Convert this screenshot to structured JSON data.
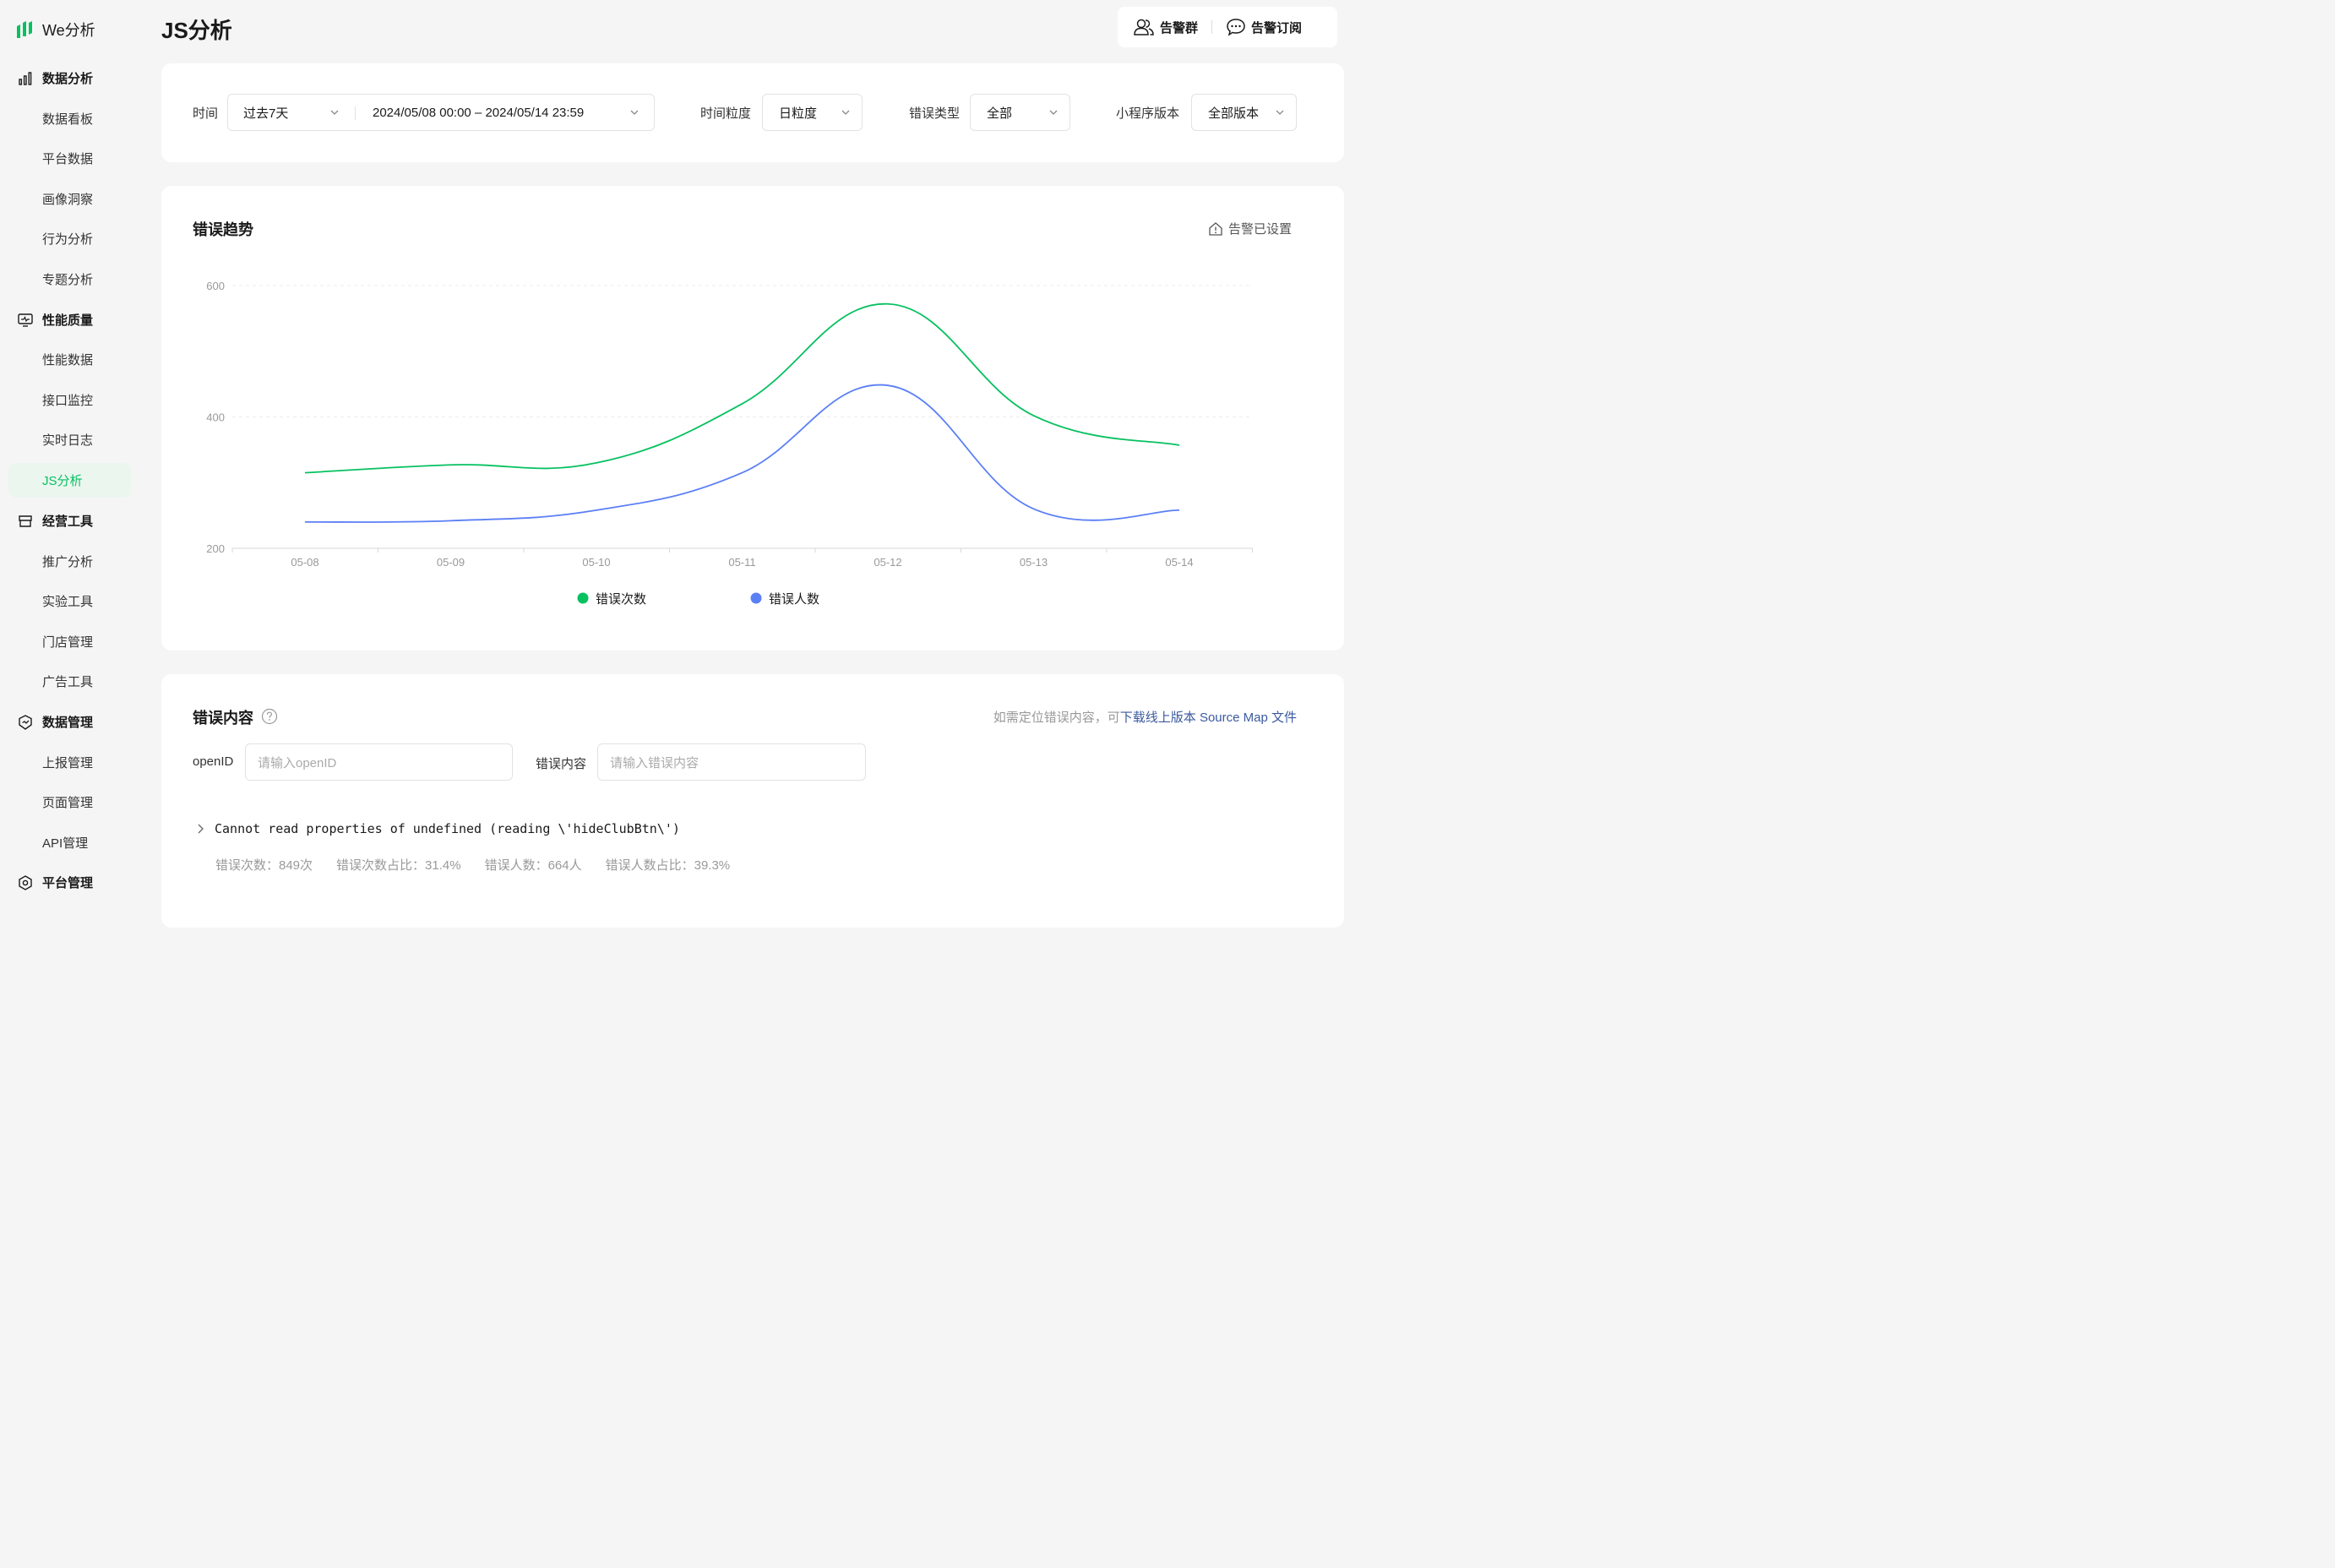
{
  "app": {
    "name": "We分析"
  },
  "sidebar": {
    "groups": [
      {
        "label": "数据分析",
        "icon": "bar-chart-icon",
        "items": [
          "数据看板",
          "平台数据",
          "画像洞察",
          "行为分析",
          "专题分析"
        ]
      },
      {
        "label": "性能质量",
        "icon": "monitor-icon",
        "items": [
          "性能数据",
          "接口监控",
          "实时日志",
          "JS分析"
        ]
      },
      {
        "label": "经营工具",
        "icon": "store-icon",
        "items": [
          "推广分析",
          "实验工具",
          "门店管理",
          "广告工具"
        ]
      },
      {
        "label": "数据管理",
        "icon": "shield-check-icon",
        "items": [
          "上报管理",
          "页面管理",
          "API管理"
        ]
      },
      {
        "label": "平台管理",
        "icon": "settings-icon",
        "items": []
      }
    ],
    "active_item": "JS分析"
  },
  "page": {
    "title": "JS分析"
  },
  "header_actions": {
    "alert_group": "告警群",
    "alert_subscribe": "告警订阅"
  },
  "filters": {
    "time_label": "时间",
    "time_preset": "过去7天",
    "time_range": "2024/05/08 00:00 – 2024/05/14 23:59",
    "granularity_label": "时间粒度",
    "granularity_value": "日粒度",
    "error_type_label": "错误类型",
    "error_type_value": "全部",
    "version_label": "小程序版本",
    "version_value": "全部版本"
  },
  "trend": {
    "title": "错误趋势",
    "alert_status": "告警已设置"
  },
  "chart_data": {
    "type": "line",
    "x": [
      "05-08",
      "05-09",
      "05-10",
      "05-11",
      "05-12",
      "05-13",
      "05-14"
    ],
    "series": [
      {
        "name": "错误次数",
        "color": "#07c160",
        "values": [
          315,
          327,
          330,
          420,
          572,
          402,
          357
        ]
      },
      {
        "name": "错误人数",
        "color": "#5b7ff6",
        "values": [
          240,
          242,
          258,
          315,
          448,
          260,
          258
        ]
      }
    ],
    "y_ticks": [
      200,
      400,
      600
    ],
    "ylim": [
      200,
      600
    ],
    "grid": true,
    "legend": "bottom"
  },
  "content": {
    "title": "错误内容",
    "hint_prefix": "如需定位错误内容，可",
    "hint_link": "下载线上版本 Source Map 文件",
    "openid_label": "openID",
    "openid_placeholder": "请输入openID",
    "error_label": "错误内容",
    "error_placeholder": "请输入错误内容",
    "errors": [
      {
        "message": "Cannot read properties of undefined (reading \\'hideClubBtn\\')",
        "count": "错误次数：849次",
        "count_ratio": "错误次数占比：31.4%",
        "users": "错误人数：664人",
        "users_ratio": "错误人数占比：39.3%"
      }
    ]
  }
}
